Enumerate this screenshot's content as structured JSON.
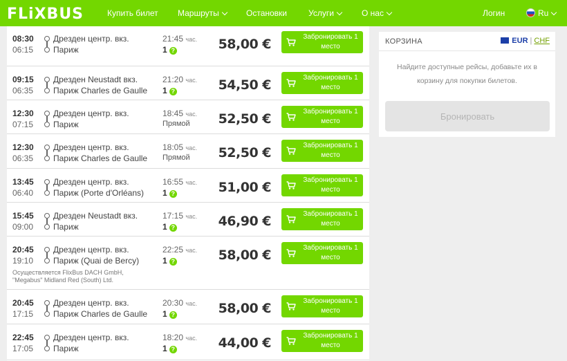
{
  "header": {
    "logo": "FLiXBUS",
    "nav": [
      "Купить билет",
      "Маршруты",
      "Остановки",
      "Услуги",
      "О нас"
    ],
    "login": "Логин",
    "lang": "Ru"
  },
  "trips": [
    {
      "dep": "08:30",
      "arr": "06:15",
      "from": "Дрезден центр. вкз.",
      "to": "Париж",
      "dur": "21:45",
      "transfers": "1",
      "price": "58,00 €"
    },
    {
      "dep": "09:15",
      "arr": "06:35",
      "from": "Дрезден Neustadt вкз.",
      "to": "Париж Charles de Gaulle",
      "dur": "21:20",
      "transfers": "1",
      "price": "54,50 €"
    },
    {
      "dep": "12:30",
      "arr": "07:15",
      "from": "Дрезден центр. вкз.",
      "to": "Париж",
      "dur": "18:45",
      "transfers": "Прямой",
      "price": "52,50 €"
    },
    {
      "dep": "12:30",
      "arr": "06:35",
      "from": "Дрезден центр. вкз.",
      "to": "Париж Charles de Gaulle",
      "dur": "18:05",
      "transfers": "Прямой",
      "price": "52,50 €"
    },
    {
      "dep": "13:45",
      "arr": "06:40",
      "from": "Дрезден центр. вкз.",
      "to": "Париж (Porte d'Orléans)",
      "dur": "16:55",
      "transfers": "1",
      "price": "51,00 €"
    },
    {
      "dep": "15:45",
      "arr": "09:00",
      "from": "Дрезден Neustadt вкз.",
      "to": "Париж",
      "dur": "17:15",
      "transfers": "1",
      "price": "46,90 €"
    },
    {
      "dep": "20:45",
      "arr": "19:10",
      "from": "Дрезден центр. вкз.",
      "to": "Париж (Quai de Bercy)",
      "dur": "22:25",
      "transfers": "1",
      "price": "58,00 €",
      "operator": "Осуществляется FlixBus DACH GmbH, \"Megabus\" Midland Red (South) Ltd."
    },
    {
      "dep": "20:45",
      "arr": "17:15",
      "from": "Дрезден центр. вкз.",
      "to": "Париж Charles de Gaulle",
      "dur": "20:30",
      "transfers": "1",
      "price": "58,00 €"
    },
    {
      "dep": "22:45",
      "arr": "17:05",
      "from": "Дрезден центр. вкз.",
      "to": "Париж",
      "dur": "18:20",
      "transfers": "1",
      "price": "44,00 €"
    }
  ],
  "labels": {
    "hours": "час.",
    "book_line1": "Забронировать 1",
    "book_line2": "место"
  },
  "basket": {
    "title": "КОРЗИНА",
    "cur_eur": "EUR",
    "cur_chf": "CHF",
    "text": "Найдите доступные рейсы, добавьте их в корзину для покупки билетов.",
    "button": "Бронировать"
  },
  "colors": {
    "brand": "#73d700",
    "text": "#444444",
    "disabled": "#e4e4e4"
  },
  "icons": [
    "cart-icon",
    "question-icon",
    "chevron-down-icon",
    "flag-ru-icon",
    "flag-eu-icon"
  ]
}
